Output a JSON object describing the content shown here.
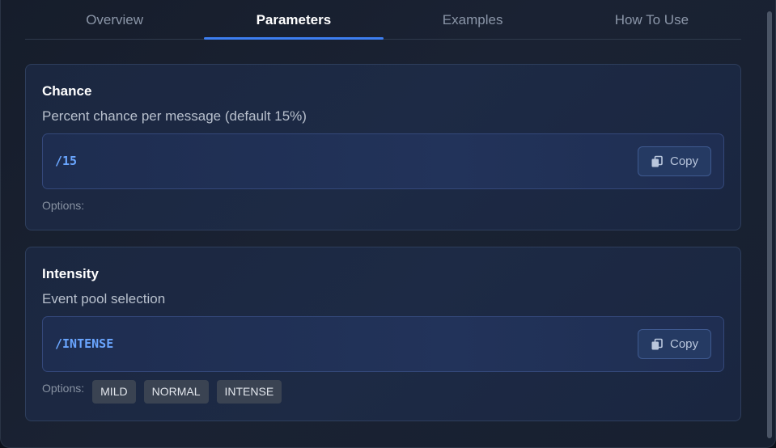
{
  "tabs": [
    {
      "label": "Overview",
      "active": false
    },
    {
      "label": "Parameters",
      "active": true
    },
    {
      "label": "Examples",
      "active": false
    },
    {
      "label": "How To Use",
      "active": false
    }
  ],
  "params": [
    {
      "title": "Chance",
      "description": "Percent chance per message (default 15%)",
      "code": "/15",
      "copy_label": "Copy",
      "options_label": "Options:",
      "options": []
    },
    {
      "title": "Intensity",
      "description": "Event pool selection",
      "code": "/INTENSE",
      "copy_label": "Copy",
      "options_label": "Options:",
      "options": [
        "MILD",
        "NORMAL",
        "INTENSE"
      ]
    }
  ],
  "colors": {
    "accent": "#3d7ef0",
    "code": "#6aa6ff",
    "background": "#161d2b"
  }
}
